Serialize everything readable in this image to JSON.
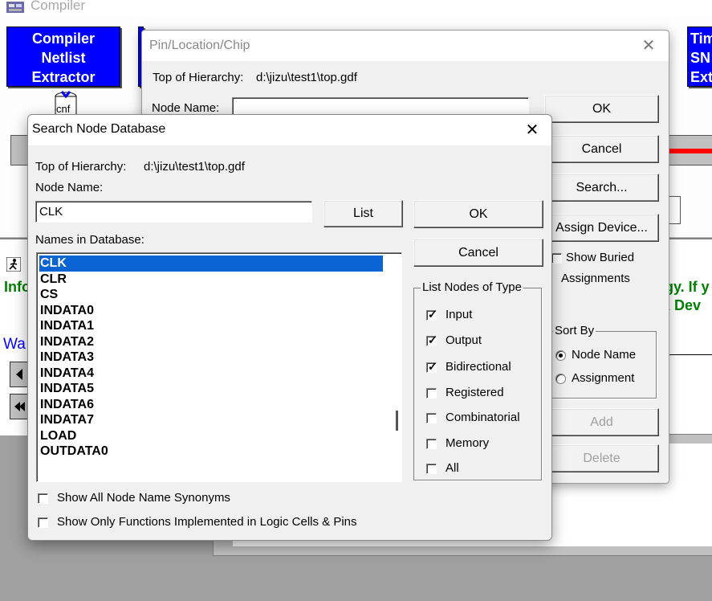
{
  "compiler": {
    "title": "Compiler",
    "modules": [
      {
        "label": "Compiler\nNetlist\nExtractor"
      },
      {
        "label": ""
      },
      {
        "label": ""
      },
      {
        "label": ""
      },
      {
        "label": "Tim\nSN\nExt"
      }
    ],
    "cnf_label": "cnf",
    "messages": {
      "info_left": "Info",
      "info_right_line1": "gy. If y",
      "info_right_line2": "K Dev",
      "wa": "Wa"
    },
    "colors": {
      "module_blue": "#0000ff",
      "info_green": "#008000",
      "progress_red": "#ff0000"
    }
  },
  "pin_dialog": {
    "title": "Pin/Location/Chip",
    "top_of_hierarchy_label": "Top of Hierarchy:",
    "top_of_hierarchy_value": "d:\\jizu\\test1\\top.gdf",
    "node_name_label": "Node Name:",
    "node_name_value": "",
    "buttons": {
      "ok": "OK",
      "cancel": "Cancel",
      "search": "Search...",
      "assign_device": "Assign Device...",
      "add": "Add",
      "delete": "Delete"
    },
    "show_buried_line1": "Show Buried",
    "show_buried_line2": "Assignments",
    "sort_by": {
      "label": "Sort By",
      "options": [
        "Node Name",
        "Assignment"
      ],
      "selected": "Node Name"
    }
  },
  "search_dialog": {
    "title": "Search Node Database",
    "top_of_hierarchy_label": "Top of Hierarchy:",
    "top_of_hierarchy_value": "d:\\jizu\\test1\\top.gdf",
    "node_name_label": "Node Name:",
    "node_name_value": "CLK",
    "list_button": "List",
    "ok_button": "OK",
    "cancel_button": "Cancel",
    "names_label": "Names in Database:",
    "names": [
      "CLK",
      "CLR",
      "CS",
      "INDATA0",
      "INDATA1",
      "INDATA2",
      "INDATA3",
      "INDATA4",
      "INDATA5",
      "INDATA6",
      "INDATA7",
      "LOAD",
      "OUTDATA0"
    ],
    "selected_name": "CLK",
    "node_types": {
      "label": "List Nodes of Type",
      "items": [
        {
          "label": "Input",
          "checked": true
        },
        {
          "label": "Output",
          "checked": true
        },
        {
          "label": "Bidirectional",
          "checked": true
        },
        {
          "label": "Registered",
          "checked": false
        },
        {
          "label": "Combinatorial",
          "checked": false
        },
        {
          "label": "Memory",
          "checked": false
        },
        {
          "label": "All",
          "checked": false
        }
      ]
    },
    "show_all_synonyms": {
      "label": "Show All Node Name Synonyms",
      "checked": false
    },
    "show_only_functions": {
      "label": "Show Only Functions Implemented in Logic Cells & Pins",
      "checked": false
    }
  }
}
